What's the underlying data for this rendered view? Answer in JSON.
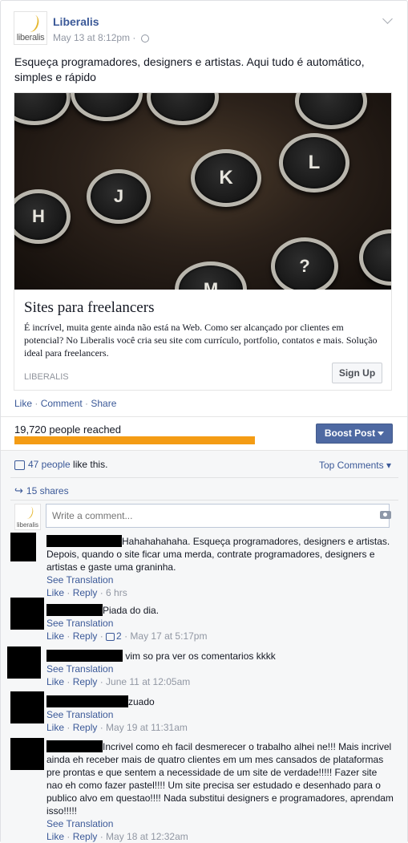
{
  "post": {
    "page_name": "Liberalis",
    "logo_text": "liberalis",
    "timestamp": "May 13 at 8:12pm",
    "meta_separator": "·",
    "text": "Esqueça programadores, designers e artistas. Aqui tudo é automático, simples e rápido"
  },
  "link": {
    "title": "Sites para freelancers",
    "description": "É incrível, muita gente ainda não está na Web. Como ser alcançado por clientes em potencial? No Liberalis você cria seu site com currículo, portfolio, contatos e mais. Solução ideal para freelancers.",
    "domain": "LIBERALIS",
    "cta": "Sign Up",
    "keys": [
      "H",
      "J",
      "K",
      "L",
      "M",
      "?"
    ]
  },
  "actions": {
    "like": "Like",
    "comment": "Comment",
    "share": "Share",
    "separator": " · "
  },
  "insights": {
    "reached": "19,720 people reached",
    "reach_fill_percent": 100,
    "boost": "Boost Post"
  },
  "ufi": {
    "likes_link": "47 people",
    "likes_suffix": " like this.",
    "top_comments": "Top Comments",
    "shares": "15 shares",
    "comment_placeholder": "Write a comment..."
  },
  "comments": [
    {
      "text": "Hahahahahaha. Esqueça programadores, designers e artistas. Depois, quando o site ficar uma merda, contrate programadores, designers e artistas e gaste uma graninha.",
      "see_translation": "See Translation",
      "like": "Like",
      "reply": "Reply",
      "likes": "",
      "time": "6 hrs"
    },
    {
      "text": "Piada do dia.",
      "see_translation": "See Translation",
      "like": "Like",
      "reply": "Reply",
      "likes": "2",
      "time": "May 17 at 5:17pm"
    },
    {
      "text": " vim so pra ver os comentarios kkkk",
      "see_translation": "See Translation",
      "like": "Like",
      "reply": "Reply",
      "likes": "",
      "time": "June 11 at 12:05am"
    },
    {
      "text": "zuado",
      "see_translation": "See Translation",
      "like": "Like",
      "reply": "Reply",
      "likes": "",
      "time": "May 19 at 11:31am"
    },
    {
      "text": "Incrivel como eh facil desmerecer o trabalho alhei ne!!! Mais incrivel ainda eh receber mais de quatro clientes em um mes cansados de plataformas pre prontas e que sentem a necessidade de um site de verdade!!!!! Fazer site nao eh como fazer pastel!!!! Um site precisa ser estudado e desenhado para o publico alvo em questao!!!! Nada substitui designers e programadores, aprendam isso!!!!!",
      "see_translation": "See Translation",
      "like": "Like",
      "reply": "Reply",
      "likes": "",
      "time": "May 18 at 12:32am"
    }
  ],
  "colors": {
    "link": "#3b5998",
    "boost": "#4e69a2",
    "reach_bar": "#f49c14",
    "meta": "#9197a3"
  }
}
